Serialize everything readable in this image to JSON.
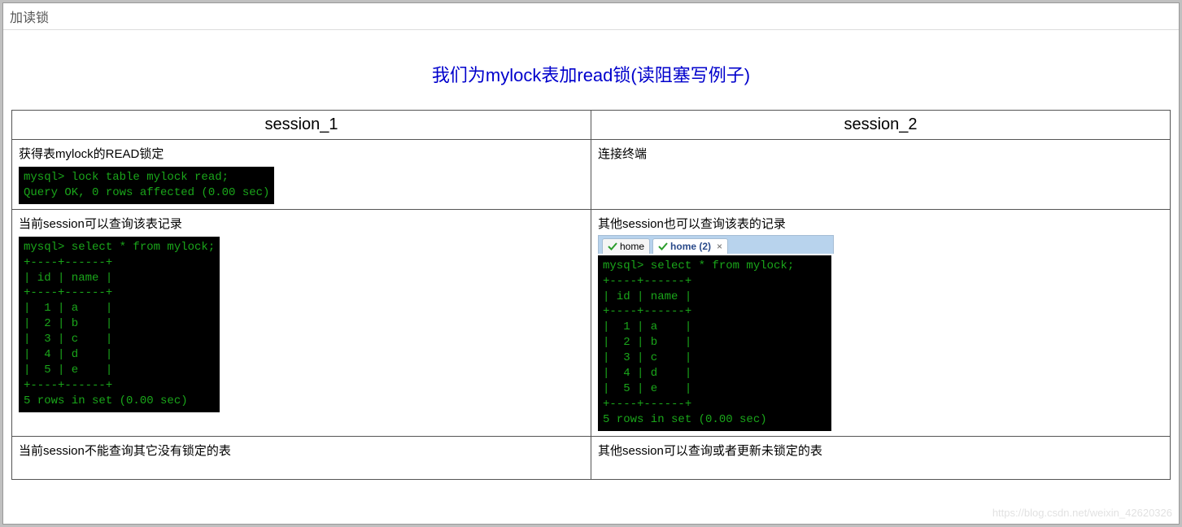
{
  "topbar": {
    "label": "加读锁"
  },
  "title": "我们为mylock表加read锁(读阻塞写例子)",
  "headers": {
    "col1": "session_1",
    "col2": "session_2"
  },
  "rows": [
    {
      "left": {
        "desc": "获得表mylock的READ锁定",
        "terminal": "mysql> lock table mylock read;\nQuery OK, 0 rows affected (0.00 sec)"
      },
      "right": {
        "desc": "连接终端"
      }
    },
    {
      "left": {
        "desc": "当前session可以查询该表记录",
        "terminal": "mysql> select * from mylock;\n+----+------+\n| id | name |\n+----+------+\n|  1 | a    |\n|  2 | b    |\n|  3 | c    |\n|  4 | d    |\n|  5 | e    |\n+----+------+\n5 rows in set (0.00 sec)"
      },
      "right": {
        "desc": "其他session也可以查询该表的记录",
        "tabs": {
          "tab1": "home",
          "tab2": "home (2)",
          "close": "×"
        },
        "terminal": "mysql> select * from mylock;\n+----+------+\n| id | name |\n+----+------+\n|  1 | a    |\n|  2 | b    |\n|  3 | c    |\n|  4 | d    |\n|  5 | e    |\n+----+------+\n5 rows in set (0.00 sec)"
      }
    },
    {
      "left": {
        "desc": "当前session不能查询其它没有锁定的表"
      },
      "right": {
        "desc": "其他session可以查询或者更新未锁定的表"
      }
    }
  ],
  "watermark": "https://blog.csdn.net/weixin_42620326",
  "chart_data": {
    "type": "table",
    "title": "mylock table contents",
    "columns": [
      "id",
      "name"
    ],
    "rows": [
      [
        1,
        "a"
      ],
      [
        2,
        "b"
      ],
      [
        3,
        "c"
      ],
      [
        4,
        "d"
      ],
      [
        5,
        "e"
      ]
    ],
    "row_count": 5,
    "query_time_sec": 0.0
  }
}
